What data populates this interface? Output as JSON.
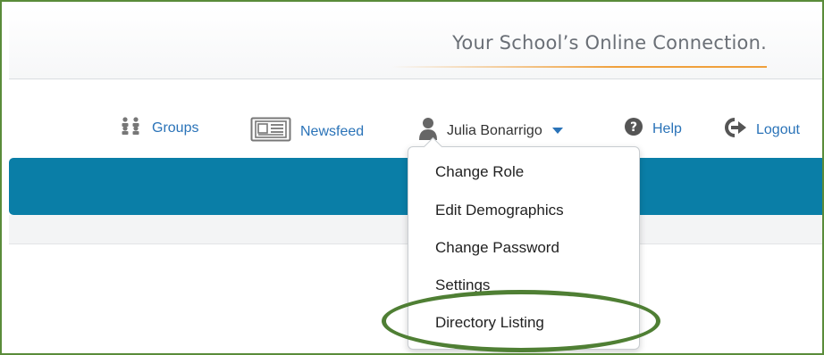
{
  "header": {
    "tagline": "Your School’s Online Connection."
  },
  "nav": {
    "items": [
      {
        "label": "Groups",
        "icon": "groups-icon"
      },
      {
        "label": "Newsfeed",
        "icon": "newsfeed-icon"
      },
      {
        "label": "Julia Bonarrigo",
        "icon": "user-icon"
      },
      {
        "label": "Help",
        "icon": "help-icon"
      },
      {
        "label": "Logout",
        "icon": "logout-icon"
      }
    ]
  },
  "user_menu": {
    "items": [
      {
        "label": "Change Role"
      },
      {
        "label": "Edit Demographics"
      },
      {
        "label": "Change Password"
      },
      {
        "label": "Settings"
      },
      {
        "label": "Directory Listing"
      }
    ]
  },
  "colors": {
    "link": "#2a73b8",
    "accent_bar": "#0a7ea7",
    "tagline_underline": "#f0a03c",
    "highlight_ellipse": "#4f7f34"
  }
}
